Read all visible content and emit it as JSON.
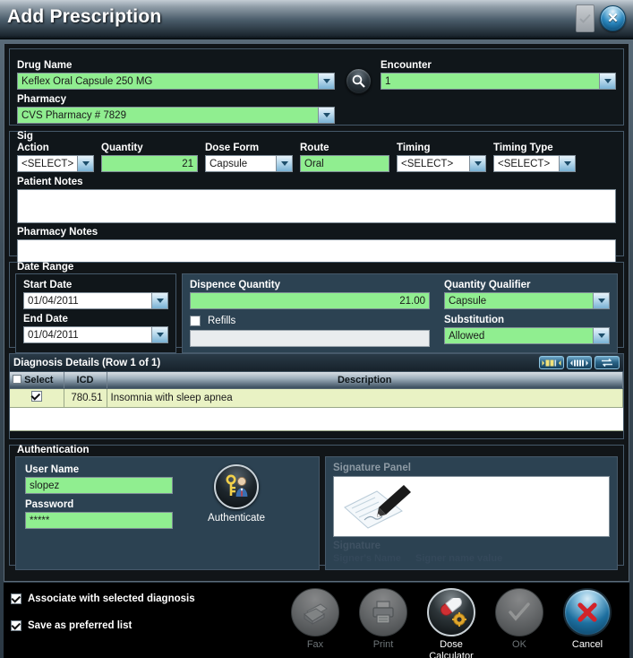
{
  "window": {
    "title": "Add Prescription",
    "titlebar_buttons": [
      {
        "name": "accept-button",
        "icon": "checkmark-icon",
        "enabled": false
      },
      {
        "name": "close-button",
        "icon": "close-x-icon",
        "enabled": true
      }
    ]
  },
  "colors": {
    "field_green": "#90EE90",
    "panel_dark": "#10161A",
    "panel_blue": "#2C4252",
    "grid_row": "#E9F2C4",
    "accent_blue": "#2A86BD",
    "cancel_red": "#D2232A"
  },
  "drug_section": {
    "drug_name_label": "Drug Name",
    "drug_name_value": "Keflex Oral Capsule 250 MG",
    "pharmacy_label": "Pharmacy",
    "pharmacy_value": "CVS Pharmacy # 7829",
    "encounter_label": "Encounter",
    "encounter_value": "1",
    "search_icon": "magnifier-icon"
  },
  "sig_section": {
    "group_label": "Sig",
    "fields": [
      {
        "label": "Action",
        "value": "<SELECT>",
        "type": "combo",
        "style": "white"
      },
      {
        "label": "Quantity",
        "value": "21",
        "type": "number",
        "style": "green"
      },
      {
        "label": "Dose Form",
        "value": "Capsule",
        "type": "combo",
        "style": "white"
      },
      {
        "label": "Route",
        "value": "Oral",
        "type": "text",
        "style": "green"
      },
      {
        "label": "Timing",
        "value": "<SELECT>",
        "type": "combo",
        "style": "white"
      },
      {
        "label": "Timing Type",
        "value": "<SELECT>",
        "type": "combo",
        "style": "white"
      }
    ],
    "patient_notes_label": "Patient Notes",
    "patient_notes_value": "",
    "pharmacy_notes_label": "Pharmacy Notes",
    "pharmacy_notes_value": ""
  },
  "date_section": {
    "group_label": "Date Range",
    "start_date_label": "Start Date",
    "start_date_value": "01/04/2011",
    "end_date_label": "End Date",
    "end_date_value": "01/04/2011",
    "dispense_qty_label": "Dispence Quantity",
    "dispense_qty_value": "21.00",
    "refills_label": "Refills",
    "refills_checked": false,
    "refills_value": "",
    "qty_qualifier_label": "Quantity Qualifier",
    "qty_qualifier_value": "Capsule",
    "substitution_label": "Substitution",
    "substitution_value": "Allowed"
  },
  "diagnosis_section": {
    "header": "Diagnosis Details (Row 1 of 1)",
    "grid_buttons": [
      {
        "name": "column-fit-icon"
      },
      {
        "name": "column-layout-icon"
      },
      {
        "name": "refresh-icon"
      }
    ],
    "columns": [
      "Select",
      "ICD",
      "Description"
    ],
    "rows": [
      {
        "selected": true,
        "icd": "780.51",
        "description": "Insomnia with sleep apnea"
      }
    ]
  },
  "auth_section": {
    "group_label": "Authentication",
    "username_label": "User Name",
    "username_value": "slopez",
    "password_label": "Password",
    "password_value": "*****",
    "authenticate_label": "Authenticate",
    "authenticate_icon": "key-user-icon",
    "signature_panel_label": "Signature Panel",
    "signature_canvas_icon": "pen-signing-document-icon",
    "signature_label": "Signature",
    "signer_name_label": "Signer's Name",
    "signer_name_value": "Signer name value"
  },
  "footer": {
    "checkboxes": [
      {
        "label": "Associate with selected diagnosis",
        "checked": true
      },
      {
        "label": "Save as preferred list",
        "checked": true
      }
    ],
    "buttons": [
      {
        "label": "Fax",
        "icon": "fax-machine-icon",
        "enabled": false
      },
      {
        "label": "Print",
        "icon": "printer-icon",
        "enabled": false
      },
      {
        "label": "Dose Calculator",
        "icon": "pill-gear-icon",
        "enabled": true
      },
      {
        "label": "OK",
        "icon": "checkmark-icon",
        "enabled": false
      },
      {
        "label": "Cancel",
        "icon": "close-x-icon",
        "enabled": true
      }
    ]
  }
}
